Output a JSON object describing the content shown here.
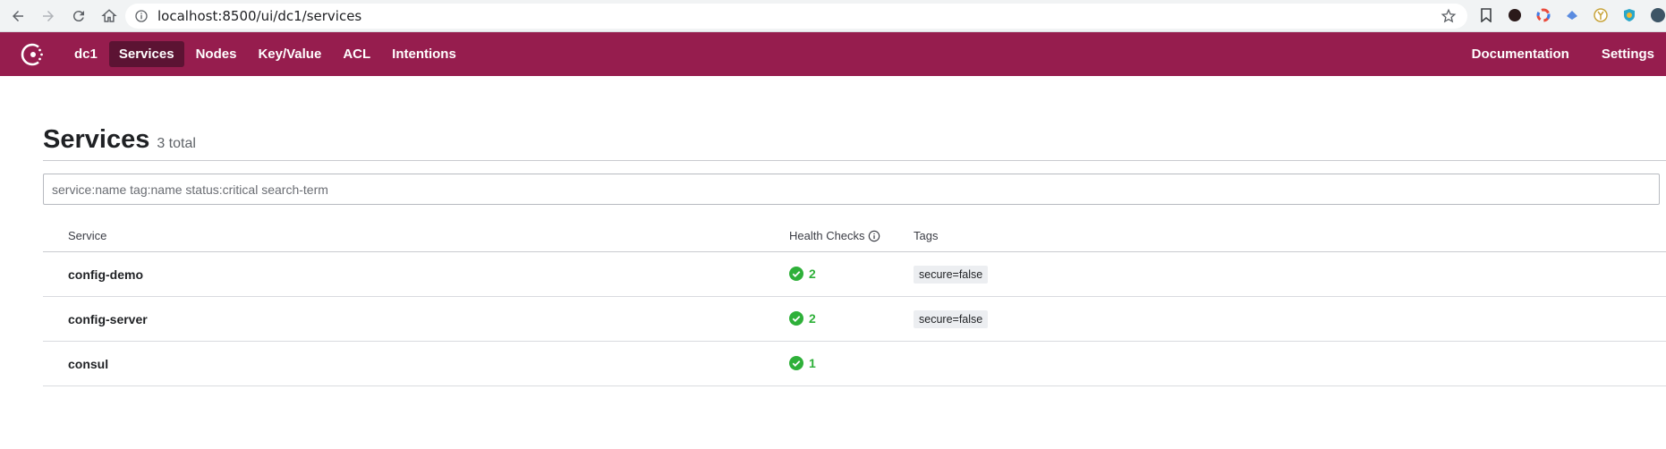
{
  "browser": {
    "url": "localhost:8500/ui/dc1/services"
  },
  "nav": {
    "datacenter": "dc1",
    "items": [
      {
        "label": "Services",
        "active": true
      },
      {
        "label": "Nodes",
        "active": false
      },
      {
        "label": "Key/Value",
        "active": false
      },
      {
        "label": "ACL",
        "active": false
      },
      {
        "label": "Intentions",
        "active": false
      }
    ],
    "right": {
      "documentation": "Documentation",
      "settings": "Settings"
    }
  },
  "page": {
    "title": "Services",
    "total": "3 total"
  },
  "search": {
    "placeholder": "service:name tag:name status:critical search-term",
    "value": ""
  },
  "table": {
    "headers": {
      "service": "Service",
      "health": "Health Checks",
      "tags": "Tags"
    },
    "rows": [
      {
        "service": "config-demo",
        "checks": "2",
        "tag": "secure=false"
      },
      {
        "service": "config-server",
        "checks": "2",
        "tag": "secure=false"
      },
      {
        "service": "consul",
        "checks": "1",
        "tag": ""
      }
    ]
  },
  "colors": {
    "brand": "#961d4e",
    "brand_active": "#5c1333",
    "passing": "#2eb039"
  },
  "icons": {
    "back": "back-arrow-icon",
    "forward": "forward-arrow-icon",
    "reload": "reload-icon",
    "home": "home-icon",
    "info": "info-icon",
    "bookmark": "star-icon",
    "logo": "consul-logo-icon",
    "health_help": "info-icon",
    "passing": "check-circle-icon"
  }
}
